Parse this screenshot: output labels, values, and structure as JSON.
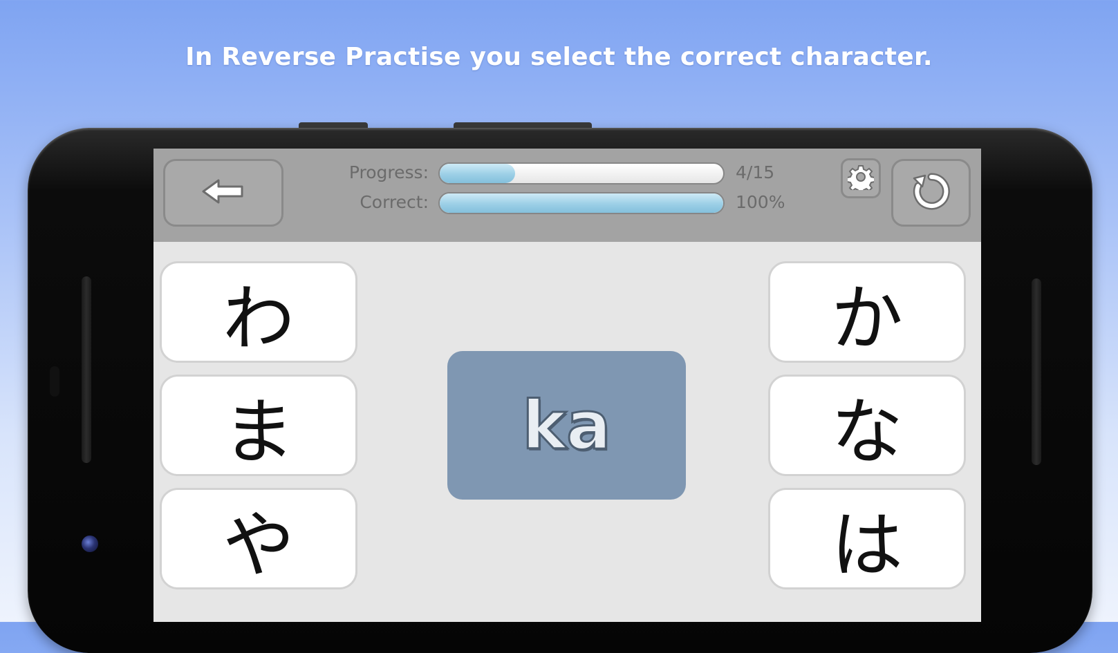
{
  "caption": "In Reverse Practise you select the correct character.",
  "topbar": {
    "progress_label": "Progress:",
    "progress_value": "4/15",
    "progress_fraction": 0.267,
    "correct_label": "Correct:",
    "correct_value": "100%",
    "correct_fraction": 1.0
  },
  "prompt": "ka",
  "choices_left": [
    "わ",
    "ま",
    "や"
  ],
  "choices_right": [
    "か",
    "な",
    "は"
  ],
  "icons": {
    "back": "back-arrow-icon",
    "settings": "gear-icon",
    "reload": "reload-icon"
  },
  "colors": {
    "background_top": "#7fa4f2",
    "topbar": "#a3a3a3",
    "prompt_card": "#7f97b2",
    "bar_fill": "#9ccfe6"
  }
}
